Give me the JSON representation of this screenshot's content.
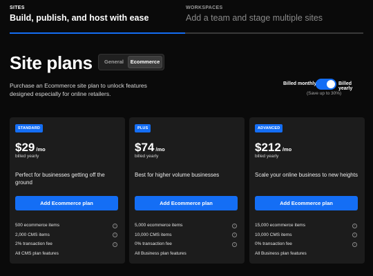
{
  "top_tabs": {
    "sites": {
      "kicker": "SITES",
      "headline": "Build, publish, and host with ease"
    },
    "workspaces": {
      "kicker": "WORKSPACES",
      "headline": "Add a team and stage multiple sites"
    }
  },
  "header": {
    "title": "Site plans",
    "segmented": {
      "general": "General",
      "ecommerce": "Ecommerce",
      "selected": "Ecommerce"
    },
    "intro": "Purchase an Ecommerce site plan to unlock features designed especially for online retailers."
  },
  "billing": {
    "monthly": "Billed monthly",
    "yearly": "Billed yearly",
    "savings": "(Save up to 30%)",
    "toggle_on": true
  },
  "plans": [
    {
      "badge": "STANDARD",
      "price": "$29",
      "per": "/mo",
      "billed": "billed yearly",
      "description": "Perfect for businesses getting off the ground",
      "cta": "Add Ecommerce plan",
      "features": [
        {
          "text": "500 ecommerce items",
          "info": true
        },
        {
          "text": "2,000 CMS items",
          "info": true
        },
        {
          "text": "2% transaction fee",
          "info": true
        },
        {
          "text": "All CMS plan features",
          "info": false
        }
      ]
    },
    {
      "badge": "PLUS",
      "price": "$74",
      "per": "/mo",
      "billed": "billed yearly",
      "description": "Best for higher volume businesses",
      "cta": "Add Ecommerce plan",
      "features": [
        {
          "text": "5,000 ecommerce items",
          "info": true
        },
        {
          "text": "10,000 CMS items",
          "info": true
        },
        {
          "text": "0% transaction fee",
          "info": true
        },
        {
          "text": "All Business plan features",
          "info": false
        }
      ]
    },
    {
      "badge": "ADVANCED",
      "price": "$212",
      "per": "/mo",
      "billed": "billed yearly",
      "description": "Scale your online business to new heights",
      "cta": "Add Ecommerce plan",
      "features": [
        {
          "text": "15,000 ecommerce items",
          "info": true
        },
        {
          "text": "10,000 CMS items",
          "info": true
        },
        {
          "text": "0% transaction fee",
          "info": true
        },
        {
          "text": "All Business plan features",
          "info": false
        }
      ]
    }
  ],
  "icons": {
    "info": "info-circle-icon"
  },
  "colors": {
    "accent": "#146ef5",
    "background": "#0a0a0a",
    "card": "#1c1c1c"
  }
}
